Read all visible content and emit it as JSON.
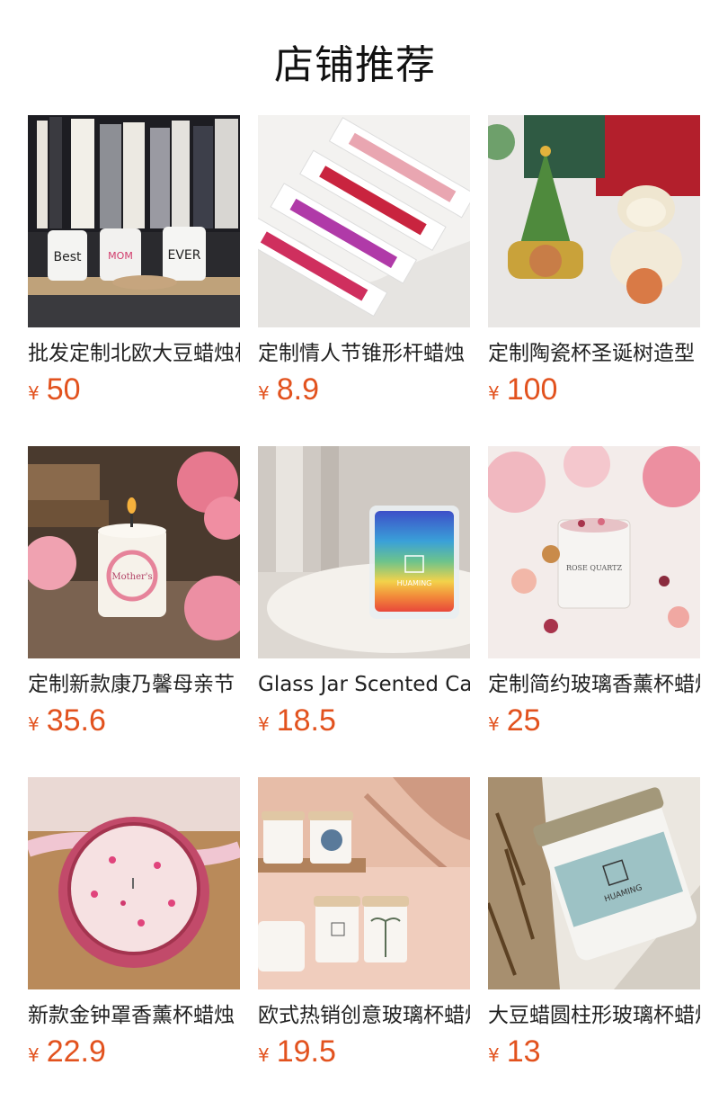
{
  "page": {
    "title": "店铺推荐"
  },
  "currency": "¥",
  "products": [
    {
      "name": "批发定制北欧大豆蜡烛杯",
      "price": "50",
      "image": "candle-mugs-on-bookshelf"
    },
    {
      "name": "定制情人节锥形杆蜡烛",
      "price": "8.9",
      "image": "taper-candles-in-boxes"
    },
    {
      "name": "定制陶瓷杯圣诞树造型",
      "price": "100",
      "image": "ceramic-christmas-tree-jars"
    },
    {
      "name": "定制新款康乃馨母亲节",
      "price": "35.6",
      "image": "mothers-day-candle"
    },
    {
      "name": "Glass Jar Scented Candle",
      "price": "18.5",
      "image": "rainbow-glass-candle"
    },
    {
      "name": "定制简约玻璃香薰杯蜡烛",
      "price": "25",
      "image": "rose-quartz-candle"
    },
    {
      "name": "新款金钟罩香薰杯蜡烛",
      "price": "22.9",
      "image": "pink-glass-flower-candle"
    },
    {
      "name": "欧式热销创意玻璃杯蜡烛",
      "price": "19.5",
      "image": "printed-candle-jars"
    },
    {
      "name": "大豆蜡圆柱形玻璃杯蜡烛",
      "price": "13",
      "image": "huaming-jar-candle"
    }
  ]
}
